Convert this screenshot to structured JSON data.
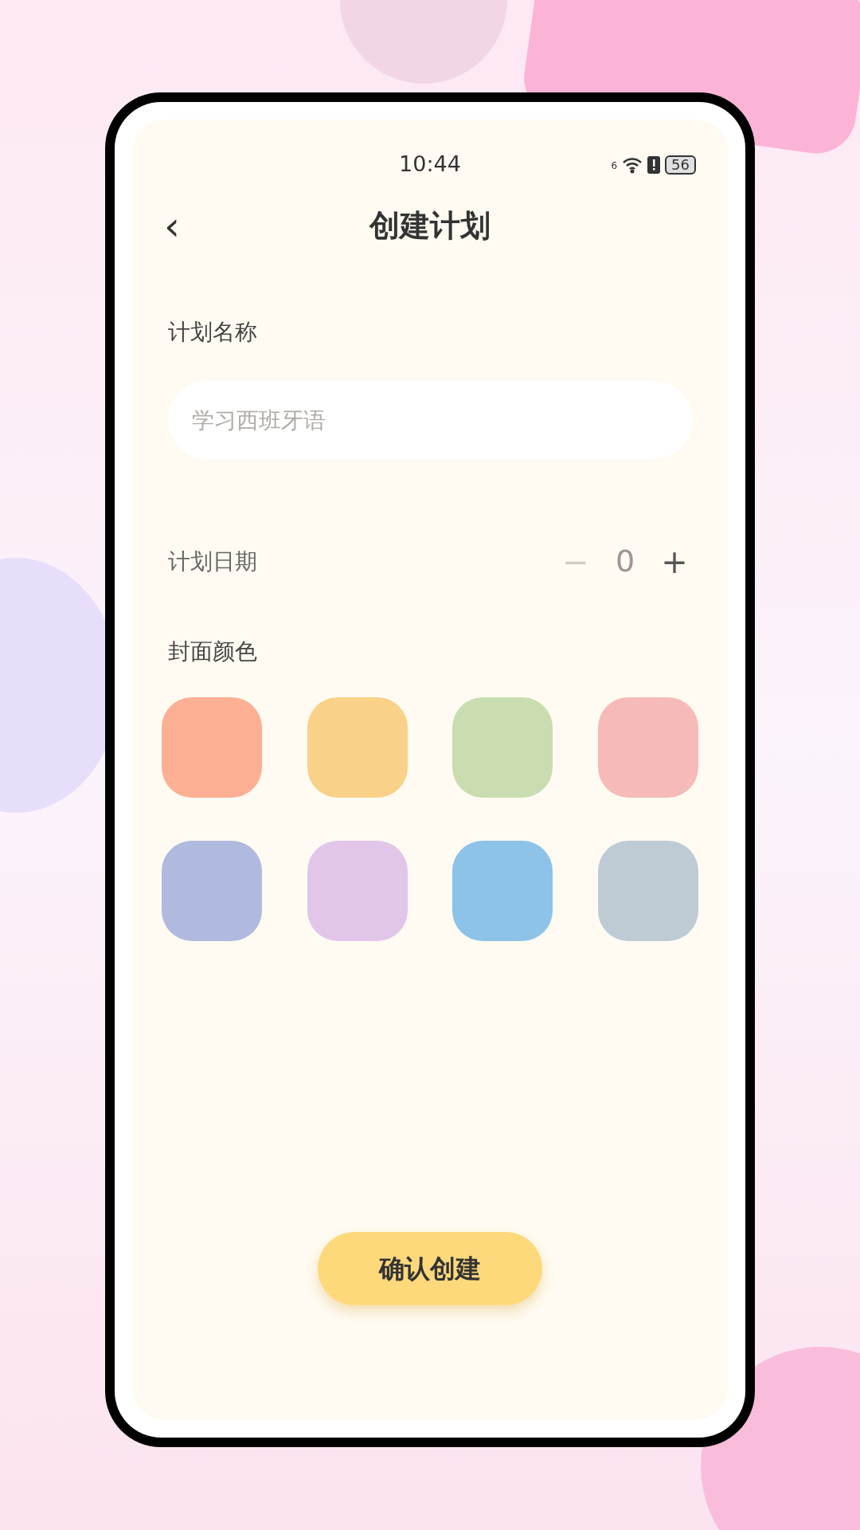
{
  "status_bar": {
    "time": "10:44",
    "signal_label": "6",
    "battery": "56"
  },
  "header": {
    "back": "‹",
    "title": "创建计划"
  },
  "plan_name": {
    "label": "计划名称",
    "placeholder": "学习西班牙语"
  },
  "plan_days": {
    "label": "计划日期",
    "value": "0",
    "minus": {
      "symbol": "−",
      "disabled": true
    },
    "plus": {
      "symbol": "+",
      "disabled": false
    }
  },
  "cover_color": {
    "label": "封面颜色",
    "swatches": [
      {
        "color": "#fdaf93"
      },
      {
        "color": "#f9d188"
      },
      {
        "color": "#c9ddb0"
      },
      {
        "color": "#f6bbb9"
      },
      {
        "color": "#b0bade"
      },
      {
        "color": "#e2c6ea"
      },
      {
        "color": "#8dc3e8"
      },
      {
        "color": "#bfcbd4"
      }
    ]
  },
  "confirm_button": "确认创建"
}
